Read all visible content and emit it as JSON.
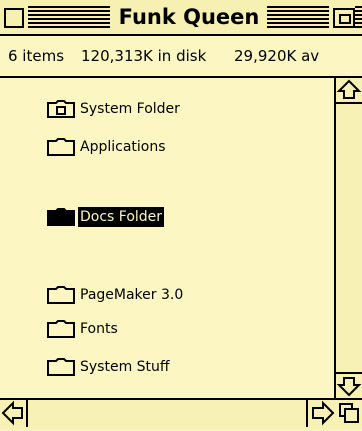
{
  "window": {
    "title": "Funk Queen",
    "info": {
      "items": "6 items",
      "in_disk": "120,313K in disk",
      "available": "29,920K av"
    }
  },
  "items": [
    {
      "label": "System Folder",
      "icon": "system-folder-icon",
      "selected": false
    },
    {
      "label": "Applications",
      "icon": "folder-icon",
      "selected": false
    },
    {
      "label": "Docs Folder",
      "icon": "folder-icon",
      "selected": true
    },
    {
      "label": "PageMaker 3.0",
      "icon": "folder-icon",
      "selected": false
    },
    {
      "label": "Fonts",
      "icon": "folder-icon",
      "selected": false
    },
    {
      "label": "System Stuff",
      "icon": "folder-icon",
      "selected": false
    }
  ],
  "colors": {
    "background": "#fbf6c2",
    "selection": "#000000"
  }
}
